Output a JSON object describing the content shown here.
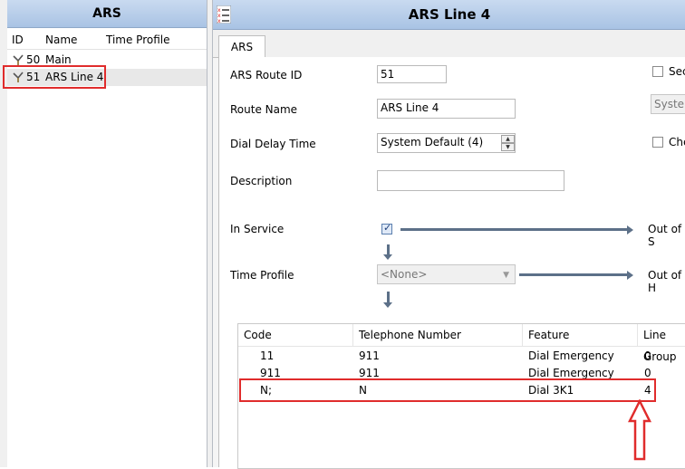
{
  "left_panel": {
    "title": "ARS",
    "columns": [
      "ID",
      "Name",
      "Time Profile"
    ],
    "rows": [
      {
        "id": "50",
        "name": "Main",
        "time_profile": ""
      },
      {
        "id": "51",
        "name": "ARS Line 4",
        "time_profile": ""
      }
    ]
  },
  "right_panel": {
    "title": "ARS Line 4",
    "tab": "ARS",
    "form": {
      "route_id_label": "ARS Route ID",
      "route_id_value": "51",
      "route_name_label": "Route Name",
      "route_name_value": "ARS Line 4",
      "dial_delay_label": "Dial Delay Time",
      "dial_delay_value": "System Default (4)",
      "description_label": "Description",
      "description_value": "",
      "in_service_label": "In Service",
      "in_service_checked": true,
      "out_of_service_label": "Out of S",
      "time_profile_label": "Time Profile",
      "time_profile_value": "<None>",
      "out_of_hours_label": "Out of H",
      "secondary_label": "Sec",
      "secondary_select": "System",
      "check_label": "Che"
    },
    "table": {
      "columns": [
        "Code",
        "Telephone Number",
        "Feature",
        "Line Group"
      ],
      "rows": [
        {
          "code": "11",
          "number": "911",
          "feature": "Dial Emergency",
          "line_group": "0"
        },
        {
          "code": "911",
          "number": "911",
          "feature": "Dial Emergency",
          "line_group": "0"
        },
        {
          "code": "N;",
          "number": "N",
          "feature": "Dial 3K1",
          "line_group": "4"
        }
      ]
    }
  },
  "colors": {
    "highlight": "#e02c2c",
    "title_bar": "#a9c3e4",
    "flow": "#5c7088"
  }
}
